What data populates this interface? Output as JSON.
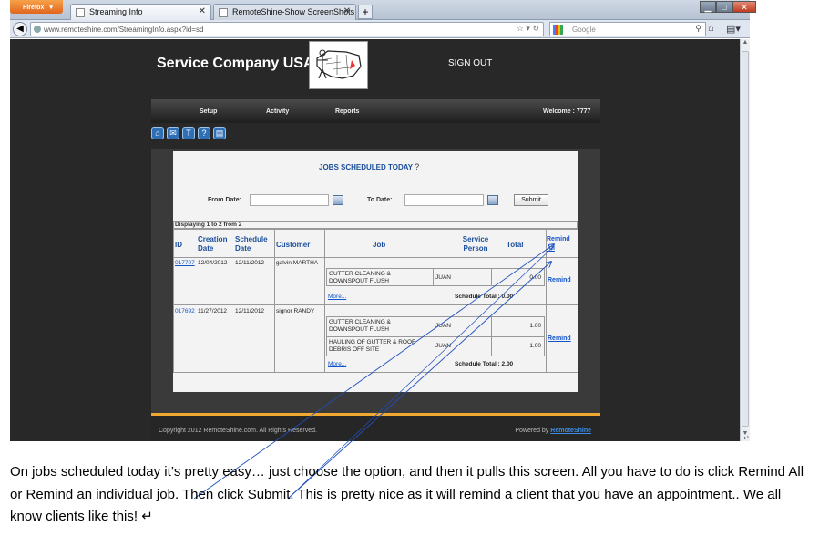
{
  "browser": {
    "app_menu_label": "Firefox",
    "tabs": [
      {
        "title": "Streaming Info"
      },
      {
        "title": "RemoteShine-Show ScreenShots"
      }
    ],
    "url": "www.remoteshine.com/StreamingInfo.aspx?id=sd",
    "search_placeholder": "Google"
  },
  "site": {
    "brand": "Service Company USA",
    "signout": "SIGN OUT",
    "menu": [
      "Setup",
      "Activity",
      "Reports"
    ],
    "welcome": "Welcome : 7777",
    "toolbar_icons": [
      "home-icon",
      "mail-icon",
      "shirt-icon",
      "help-icon",
      "document-icon"
    ]
  },
  "jobs": {
    "title": "JOBS SCHEDULED TODAY",
    "help_glyph": "?",
    "from_label": "From Date:",
    "to_label": "To Date:",
    "submit_label": "Submit",
    "displaying": "Displaying 1 to 2 from 2",
    "headers": {
      "id": "ID",
      "creation": "Creation Date",
      "schedule": "Schedule Date",
      "customer": "Customer",
      "job": "Job",
      "service_person": "Service Person",
      "total": "Total",
      "remind_all": "Remind All"
    },
    "rows": [
      {
        "id": "017707",
        "creation": "12/04/2012",
        "schedule": "12/11/2012",
        "customer": "galvin MARTHA",
        "jobs": [
          {
            "name": "GUTTER CLEANING & DOWNSPOUT FLUSH",
            "person": "JUAN",
            "total": "0.00"
          }
        ],
        "more": "More...",
        "schedule_total": "Schedule Total : 0.00",
        "remind": "Remind"
      },
      {
        "id": "017692",
        "creation": "11/27/2012",
        "schedule": "12/11/2012",
        "customer": "signor RANDY",
        "jobs": [
          {
            "name": "GUTTER CLEANING & DOWNSPOUT FLUSH",
            "person": "JUAN",
            "total": "1.00"
          },
          {
            "name": "HAULING OF GUTTER & ROOF DEBRIS OFF SITE",
            "person": "JUAN",
            "total": "1.00"
          }
        ],
        "more": "More...",
        "schedule_total": "Schedule Total : 2.00",
        "remind": "Remind"
      }
    ]
  },
  "footer": {
    "copyright": "Copyright 2012 RemoteShine.com. All Rights Reserved.",
    "powered_by": "Powered by",
    "powered_link": "RemoteShine"
  },
  "annotation": "On jobs scheduled today it’s pretty easy… just choose the option, and then it pulls this screen. All you have to do is click Remind All or Remind an individual job. Then click Submit.  This is pretty nice as it will remind a client that you have an appointment..  We all know clients like this! ↵"
}
